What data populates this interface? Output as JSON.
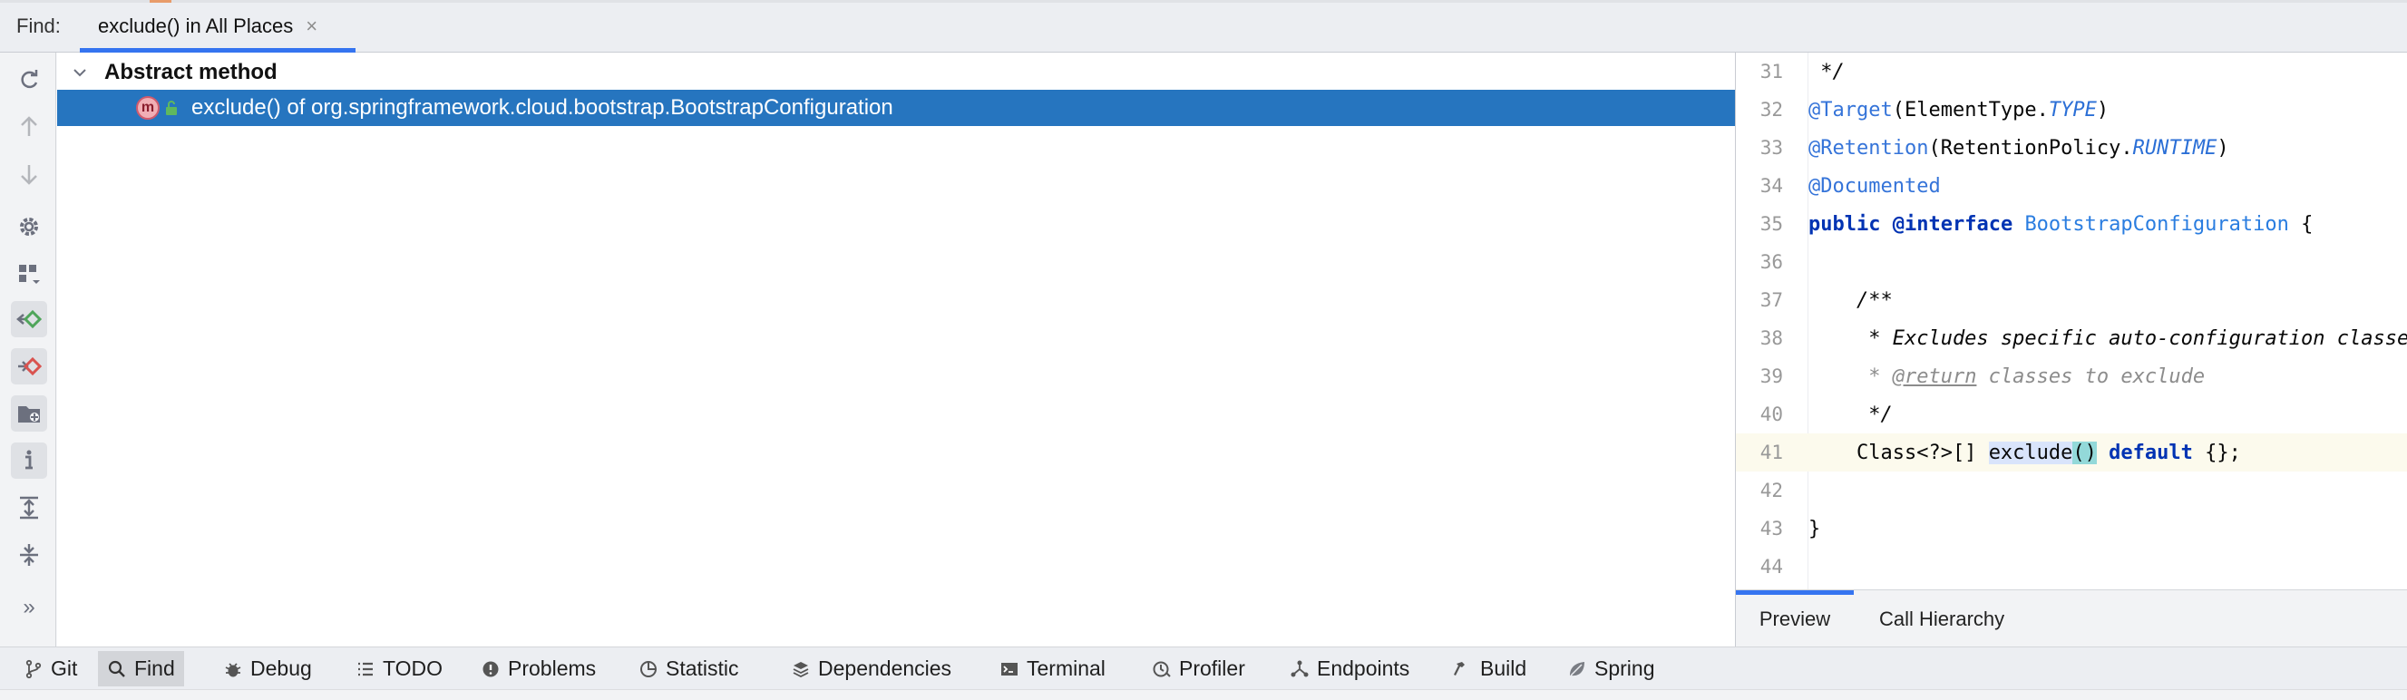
{
  "header": {
    "find_label": "Find:",
    "tab_title": "exclude() in All Places",
    "tab_close": "×"
  },
  "toolbar": {
    "buttons": [
      {
        "icon": "rerun-icon"
      },
      {
        "icon": "arrow-up-icon"
      },
      {
        "icon": "arrow-down-icon"
      },
      {
        "icon": "gear-icon"
      },
      {
        "icon": "group-by-icon"
      },
      {
        "icon": "show-read-access-icon"
      },
      {
        "icon": "show-write-access-icon"
      },
      {
        "icon": "group-by-directory-icon"
      },
      {
        "icon": "info-icon"
      },
      {
        "icon": "expand-all-icon"
      },
      {
        "icon": "collapse-all-icon"
      },
      {
        "icon": "more-icon",
        "label": "»"
      }
    ]
  },
  "results": {
    "group_label": "Abstract method",
    "method_badge": "m",
    "selected_item": "exclude() of org.springframework.cloud.bootstrap.BootstrapConfiguration"
  },
  "preview": {
    "lines": [
      {
        "n": "31",
        "code": " */"
      },
      {
        "n": "32",
        "anno": "@Target",
        "rest": "(ElementType.",
        "const": "TYPE",
        "end": ")"
      },
      {
        "n": "33",
        "anno": "@Retention",
        "rest": "(RetentionPolicy.",
        "const": "RUNTIME",
        "end": ")"
      },
      {
        "n": "34",
        "anno": "@Documented"
      },
      {
        "n": "35",
        "kw1": "public",
        "kw2": "@interface",
        "cls": "BootstrapConfiguration",
        "end": " {"
      },
      {
        "n": "36"
      },
      {
        "n": "37",
        "com": "    /**"
      },
      {
        "n": "38",
        "com": "     * Excludes specific auto-configuration classes such that they will never be applied."
      },
      {
        "n": "39",
        "com_pre": "     * ",
        "doctag": "@return",
        "com_post": " classes to exclude"
      },
      {
        "n": "40",
        "com": "     */"
      },
      {
        "n": "41",
        "pre": "    Class<?>[] ",
        "hl": "exclude",
        "paren": "()",
        "kw": "default",
        "end": " {};"
      },
      {
        "n": "42"
      },
      {
        "n": "43",
        "code": "}"
      },
      {
        "n": "44"
      }
    ],
    "tabs": [
      "Preview",
      "Call Hierarchy"
    ]
  },
  "bottombar": {
    "items": [
      {
        "label": "Git",
        "icon": "git-branch-icon"
      },
      {
        "label": "Find",
        "icon": "search-icon",
        "active": true
      },
      {
        "label": "Debug",
        "icon": "bug-icon"
      },
      {
        "label": "TODO",
        "icon": "list-icon"
      },
      {
        "label": "Problems",
        "icon": "problems-icon"
      },
      {
        "label": "Statistic",
        "icon": "statistic-icon"
      },
      {
        "label": "Dependencies",
        "icon": "layers-icon"
      },
      {
        "label": "Terminal",
        "icon": "terminal-icon"
      },
      {
        "label": "Profiler",
        "icon": "profiler-icon"
      },
      {
        "label": "Endpoints",
        "icon": "endpoints-icon"
      },
      {
        "label": "Build",
        "icon": "hammer-icon"
      },
      {
        "label": "Spring",
        "icon": "spring-leaf-icon"
      }
    ]
  },
  "colors": {
    "selection": "#2675bf",
    "accent": "#3574f0",
    "annotation": "#3574d9",
    "keyword": "#0033b3",
    "comment": "#8c8c8c"
  }
}
